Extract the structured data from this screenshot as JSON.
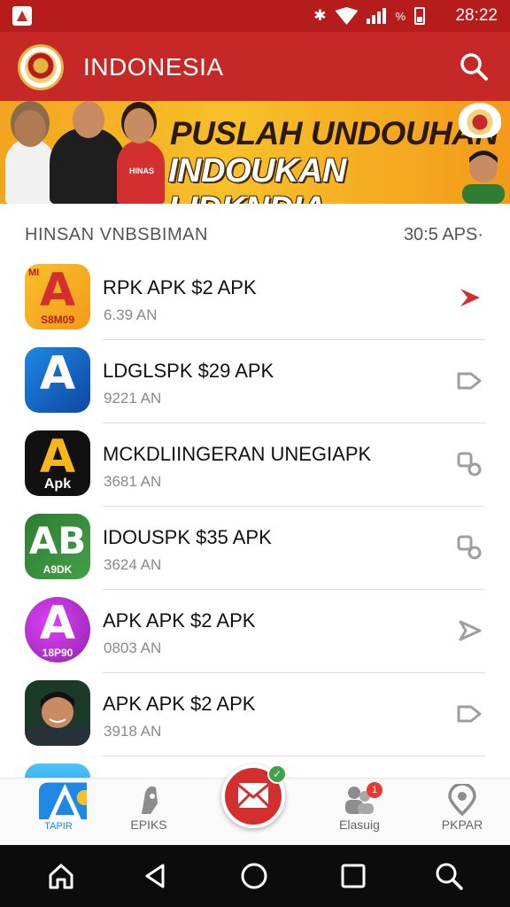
{
  "status_bar": {
    "time": "28:22",
    "battery_symbol": "%"
  },
  "header": {
    "title": "INDONESIA"
  },
  "banner": {
    "line1": "PUSLAH UNDOUHAN",
    "line2": "INDOUKAN LIDKNDIA",
    "shirt_text": "HINAS"
  },
  "section": {
    "title": "HINSAN  VNBSBIMAN",
    "count": "30:5 APS·"
  },
  "apps": [
    {
      "name": "RPK APK  $2 APK",
      "meta": "6.39 AN",
      "icon_glyph": "A",
      "icon_sub": "S8M09",
      "icon_badge": "MI",
      "action_icon": "red-arrow-icon"
    },
    {
      "name": "LDGLSPK  $29 APK",
      "meta": "9221 AN",
      "icon_glyph": "A",
      "icon_sub": "",
      "action_icon": "tag-icon"
    },
    {
      "name": "MCKDLIINGERAN  UNEGIAPK",
      "meta": "3681 AN",
      "icon_glyph": "A",
      "icon_sub": "Apk",
      "action_icon": "key-icon"
    },
    {
      "name": "IDOUSPK  $35 APK",
      "meta": "3624 AN",
      "icon_glyph": "AB",
      "icon_sub": "A9DK",
      "action_icon": "key-icon"
    },
    {
      "name": "APK APK  $2 APK",
      "meta": "0803 AN",
      "icon_glyph": "A",
      "icon_sub": "18P90",
      "action_icon": "send-icon"
    },
    {
      "name": "APK APK  $2 APK",
      "meta": "3918 AN",
      "icon_glyph": "",
      "icon_sub": "",
      "action_icon": "tag-icon"
    }
  ],
  "bottom_nav": {
    "items": [
      {
        "label": "TAPIR"
      },
      {
        "label": "EPIKS"
      },
      {
        "label": "Elasuig",
        "badge": "1"
      },
      {
        "label": "PKPAR"
      }
    ],
    "fab_badge": "✓"
  },
  "colors": {
    "primary": "#c62828",
    "status_bar": "#b71c1c",
    "banner": "#f7c02a",
    "accent_red": "#d32f2f"
  }
}
